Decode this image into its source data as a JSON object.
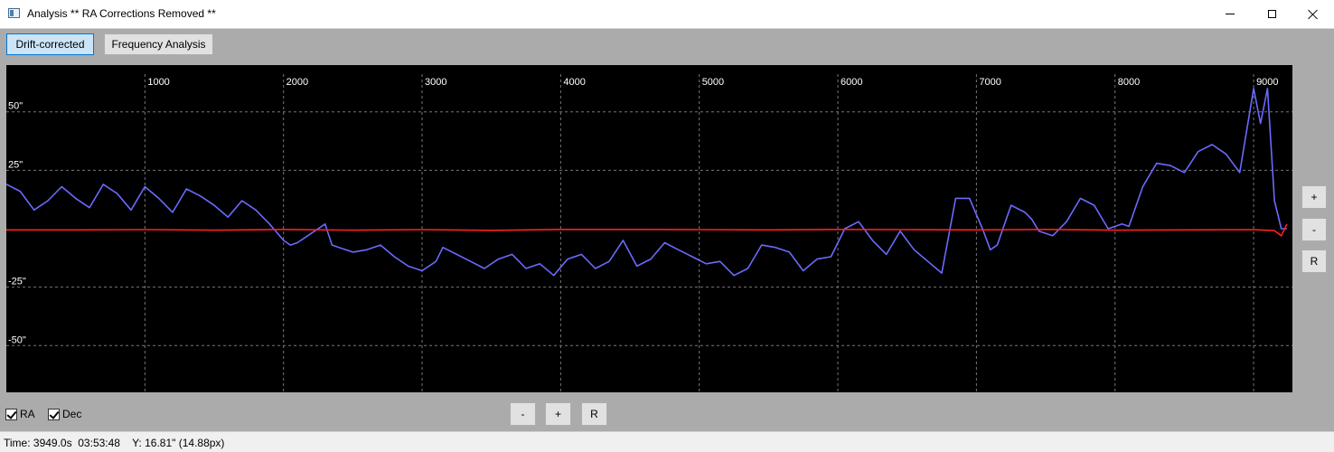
{
  "window": {
    "title": "Analysis ** RA Corrections Removed **"
  },
  "toolbar": {
    "drift_corrected_label": "Drift-corrected",
    "frequency_analysis_label": "Frequency Analysis"
  },
  "side_controls": {
    "zoom_in": "+",
    "zoom_out": "-",
    "reset": "R"
  },
  "bottom_controls": {
    "zoom_out": "-",
    "zoom_in": "+",
    "reset": "R"
  },
  "checkboxes": {
    "ra_label": "RA",
    "ra_checked": true,
    "dec_label": "Dec",
    "dec_checked": true
  },
  "status": {
    "text": "Time: 3949.0s  03:53:48    Y: 16.81\" (14.88px)"
  },
  "chart_data": {
    "type": "line",
    "title": "",
    "xlabel": "",
    "ylabel": "",
    "xlim": [
      0,
      9280
    ],
    "ylim": [
      -70,
      70
    ],
    "grid": true,
    "x_ticks": [
      1000,
      2000,
      3000,
      4000,
      5000,
      6000,
      7000,
      8000,
      9000
    ],
    "x_tick_labels": [
      "1000",
      "2000",
      "3000",
      "4000",
      "5000",
      "6000",
      "7000",
      "8000",
      "9000"
    ],
    "y_ticks": [
      50,
      25,
      -25,
      -50
    ],
    "y_tick_labels": [
      "50\"",
      "25\"",
      "-25\"",
      "-50\""
    ],
    "colors": {
      "ra": "#6a6aff",
      "dec": "#ff2020",
      "grid": "#777777",
      "background": "#000000"
    },
    "series": [
      {
        "key": "ra",
        "x": [
          0,
          100,
          200,
          300,
          400,
          500,
          600,
          700,
          800,
          900,
          1000,
          1100,
          1200,
          1300,
          1400,
          1500,
          1600,
          1700,
          1800,
          1900,
          2000,
          2050,
          2100,
          2200,
          2300,
          2350,
          2400,
          2500,
          2600,
          2700,
          2800,
          2900,
          3000,
          3100,
          3150,
          3250,
          3350,
          3450,
          3550,
          3650,
          3750,
          3850,
          3950,
          4050,
          4150,
          4250,
          4350,
          4450,
          4550,
          4650,
          4750,
          4850,
          4950,
          5050,
          5150,
          5250,
          5350,
          5450,
          5550,
          5650,
          5750,
          5850,
          5950,
          6050,
          6150,
          6250,
          6350,
          6450,
          6550,
          6650,
          6750,
          6850,
          6950,
          7050,
          7100,
          7150,
          7250,
          7350,
          7400,
          7450,
          7550,
          7650,
          7750,
          7850,
          7950,
          8050,
          8100,
          8200,
          8300,
          8400,
          8500,
          8600,
          8700,
          8800,
          8900,
          9000,
          9050,
          9100,
          9150,
          9200,
          9220,
          9240
        ],
        "y": [
          19,
          16,
          8,
          12,
          18,
          13,
          9,
          19,
          15,
          8,
          18,
          13,
          7,
          17,
          14,
          10,
          5,
          12,
          8,
          2,
          -5,
          -7,
          -6,
          -2,
          2,
          -7,
          -8,
          -10,
          -9,
          -7,
          -12,
          -16,
          -18,
          -14,
          -8,
          -11,
          -14,
          -17,
          -13,
          -11,
          -17,
          -15,
          -20,
          -13,
          -11,
          -17,
          -14,
          -5,
          -16,
          -13,
          -6,
          -9,
          -12,
          -15,
          -14,
          -20,
          -17,
          -7,
          -8,
          -10,
          -18,
          -13,
          -12,
          0,
          3,
          -5,
          -11,
          -1,
          -9,
          -14,
          -19,
          13,
          13,
          -1,
          -9,
          -7,
          10,
          7,
          4,
          -1,
          -3,
          3,
          13,
          10,
          0,
          2,
          1,
          18,
          28,
          27,
          24,
          33,
          36,
          32,
          24,
          60,
          45,
          60,
          12,
          0,
          0,
          0
        ],
        "values_note": "RA trace (arcsec)"
      },
      {
        "key": "dec",
        "x": [
          0,
          500,
          1000,
          1500,
          2000,
          2500,
          3000,
          3500,
          4000,
          4500,
          5000,
          5500,
          6000,
          6500,
          7000,
          7500,
          8000,
          8500,
          9000,
          9150,
          9200,
          9240
        ],
        "y": [
          -0.5,
          -0.5,
          -0.4,
          -0.6,
          -0.3,
          -0.6,
          -0.4,
          -0.7,
          -0.3,
          -0.3,
          -0.4,
          -0.5,
          -0.3,
          -0.4,
          -0.5,
          -0.3,
          -0.6,
          -0.5,
          -0.4,
          -0.8,
          -3,
          2
        ]
      }
    ]
  }
}
